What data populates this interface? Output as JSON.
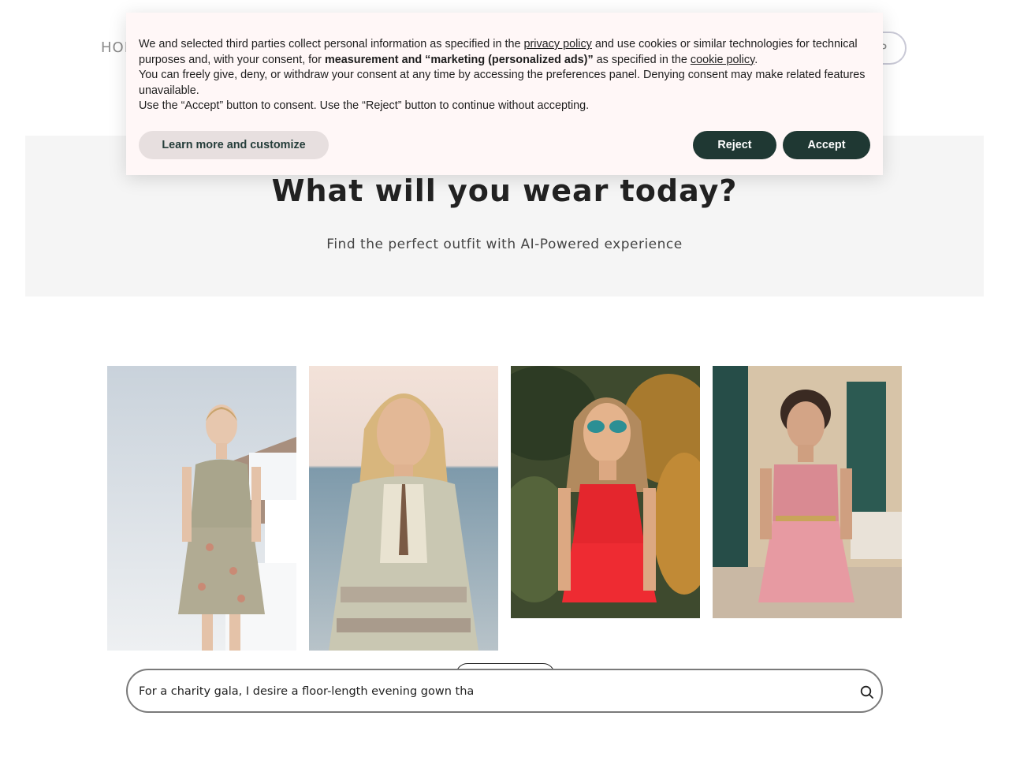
{
  "header": {
    "nav_home": "HOME",
    "signup_label": "UP"
  },
  "hero": {
    "title": "What will you wear today?",
    "subtitle": "Find the perfect outfit with AI-Powered experience",
    "background": "#f5f5f5"
  },
  "gallery": {
    "items": [
      {
        "icon": "woman-floral-slip-dress-image"
      },
      {
        "icon": "woman-boho-lace-kimono-image"
      },
      {
        "icon": "woman-red-tiered-top-image"
      },
      {
        "icon": "woman-pink-wrap-dress-image"
      }
    ]
  },
  "search": {
    "value": "For a charity gala, I desire a floor-length evening gown tha",
    "icon": "search-icon"
  },
  "cookie_banner": {
    "line1_pre": "We and selected third parties collect personal information as specified in the ",
    "privacy_link": "privacy policy",
    "line1_mid": " and use cookies or similar technologies for technical purposes and, with your consent, for ",
    "bold_text": "measurement and “marketing (personalized ads)”",
    "line1_post": " as specified in the ",
    "cookie_link": "cookie policy",
    "line1_end": ".",
    "line2": "You can freely give, deny, or withdraw your consent at any time by accessing the preferences panel. Denying consent may make related features unavailable.",
    "line3": "Use the “Accept” button to consent. Use the “Reject” button to continue without accepting.",
    "learn_more_label": "Learn more and customize",
    "reject_label": "Reject",
    "accept_label": "Accept",
    "background": "#fff7f7",
    "button_color": "#1f3833"
  }
}
